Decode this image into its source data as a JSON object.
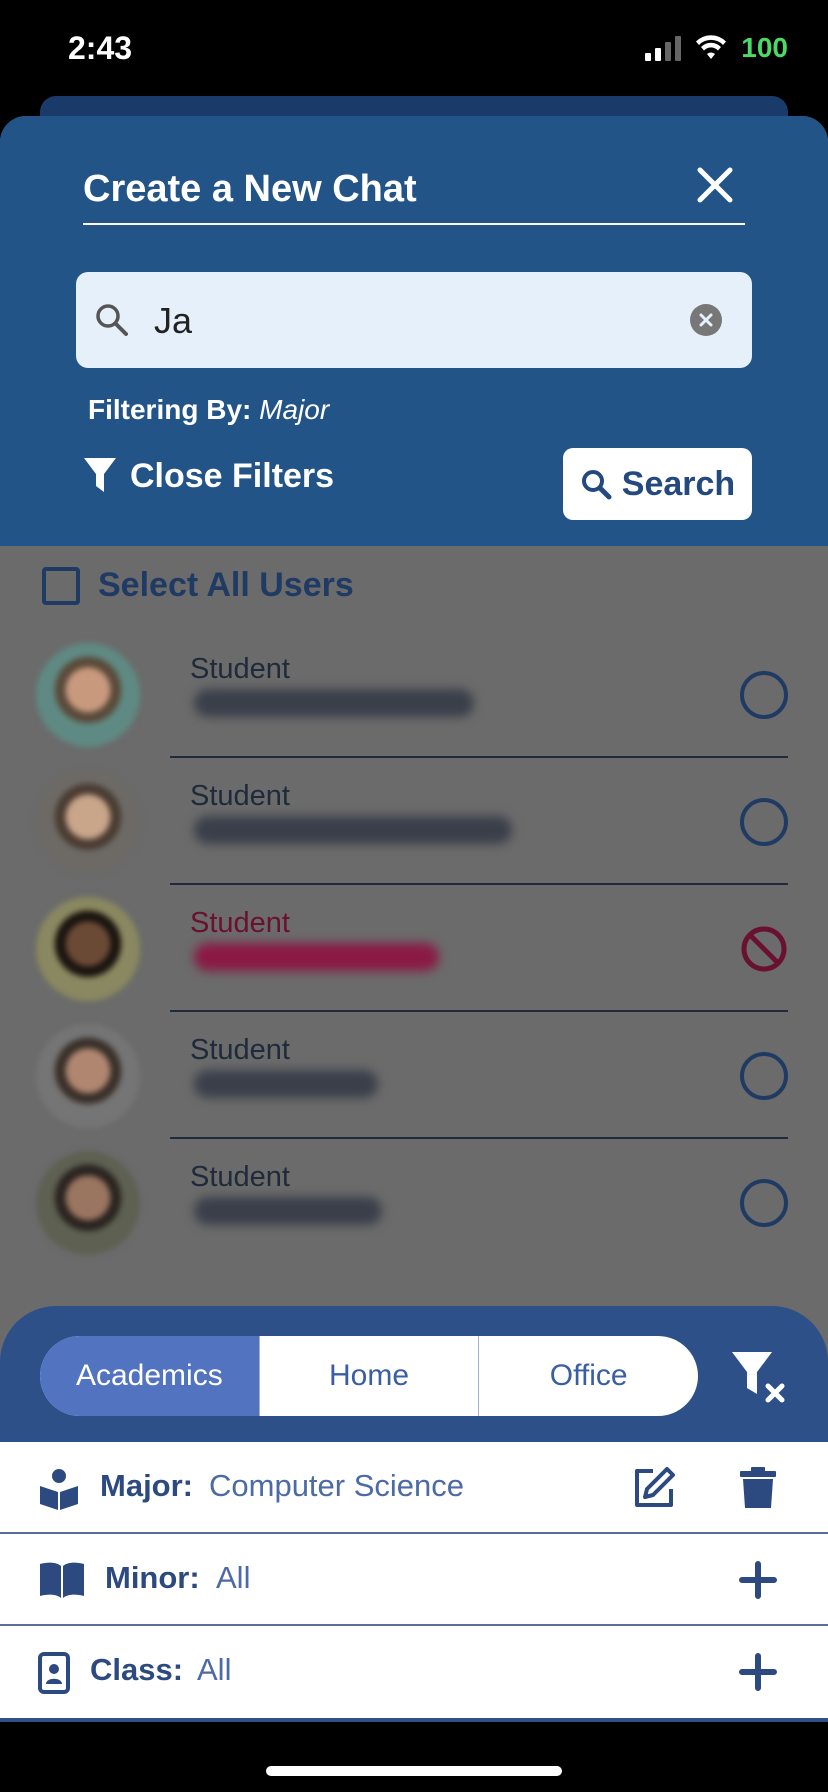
{
  "status": {
    "time": "2:43",
    "battery": "100"
  },
  "header": {
    "title": "Create a New Chat"
  },
  "search": {
    "value": "Ja",
    "placeholder": ""
  },
  "filtering": {
    "label": "Filtering By:",
    "value": "Major"
  },
  "close_filters_label": "Close Filters",
  "search_button_label": "Search",
  "select_all_label": "Select All Users",
  "users": [
    {
      "role": "Student",
      "blocked": false
    },
    {
      "role": "Student",
      "blocked": false
    },
    {
      "role": "Student",
      "blocked": true
    },
    {
      "role": "Student",
      "blocked": false
    },
    {
      "role": "Student",
      "blocked": false
    }
  ],
  "tabs": [
    {
      "label": "Academics",
      "active": true
    },
    {
      "label": "Home",
      "active": false
    },
    {
      "label": "Office",
      "active": false
    }
  ],
  "filters": [
    {
      "key": "Major:",
      "value": "Computer Science",
      "actions": [
        "edit-icon",
        "trash-icon"
      ]
    },
    {
      "key": "Minor:",
      "value": "All",
      "actions": [
        "plus-icon"
      ]
    },
    {
      "key": "Class:",
      "value": "All",
      "actions": [
        "plus-icon"
      ]
    }
  ],
  "colors": {
    "header_bg": "#235487",
    "overlay_bg": "#6b6b6b",
    "tabs_panel_bg": "#2d5089",
    "active_tab_bg": "#5273bf",
    "blocked_color": "#6a1030"
  }
}
